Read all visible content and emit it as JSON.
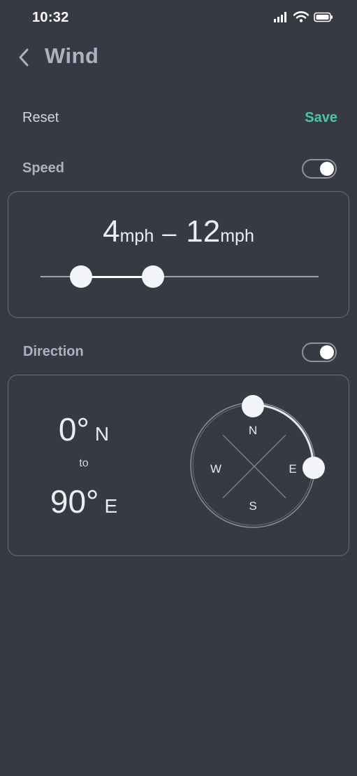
{
  "status": {
    "time": "10:32"
  },
  "header": {
    "title": "Wind"
  },
  "actions": {
    "reset_label": "Reset",
    "save_label": "Save"
  },
  "speed": {
    "label": "Speed",
    "enabled": true,
    "min_value": "4",
    "max_value": "12",
    "unit": "mph",
    "slider_min_fraction": 0.145,
    "slider_max_fraction": 0.405
  },
  "direction": {
    "label": "Direction",
    "enabled": true,
    "from_degrees": "0°",
    "from_cardinal": "N",
    "to_label": "to",
    "to_degrees": "90°",
    "to_cardinal": "E",
    "compass": {
      "n": "N",
      "e": "E",
      "s": "S",
      "w": "W"
    }
  },
  "colors": {
    "background": "#373a42",
    "accent": "#49c7ae",
    "label": "#a9b3c3"
  }
}
